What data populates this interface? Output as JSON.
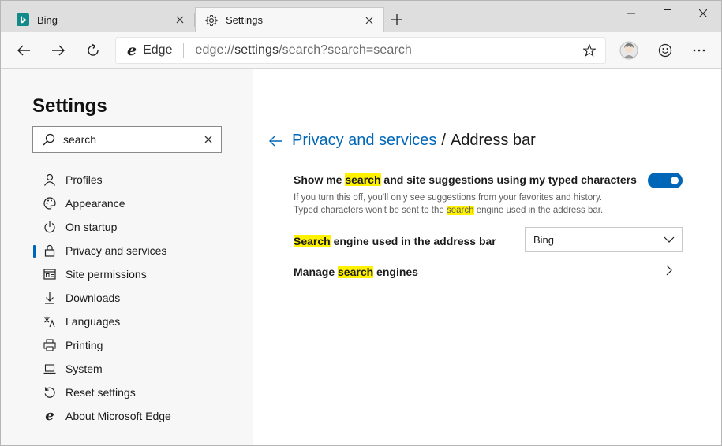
{
  "tabs": [
    {
      "title": "Bing",
      "icon": "bing-icon"
    },
    {
      "title": "Settings",
      "icon": "gear-icon"
    }
  ],
  "address": {
    "brand": "Edge",
    "url_scheme": "edge://",
    "url_host": "settings",
    "url_path": "/search?search=search"
  },
  "sidebar": {
    "title": "Settings",
    "search_value": "search",
    "items": [
      {
        "label": "Profiles",
        "icon": "person-icon"
      },
      {
        "label": "Appearance",
        "icon": "palette-icon"
      },
      {
        "label": "On startup",
        "icon": "power-icon"
      },
      {
        "label": "Privacy and services",
        "icon": "lock-icon",
        "selected": true
      },
      {
        "label": "Site permissions",
        "icon": "site-permissions-icon"
      },
      {
        "label": "Downloads",
        "icon": "download-icon"
      },
      {
        "label": "Languages",
        "icon": "languages-icon"
      },
      {
        "label": "Printing",
        "icon": "printer-icon"
      },
      {
        "label": "System",
        "icon": "laptop-icon"
      },
      {
        "label": "Reset settings",
        "icon": "reset-icon"
      },
      {
        "label": "About Microsoft Edge",
        "icon": "edge-logo-icon"
      }
    ]
  },
  "main": {
    "breadcrumb_parent": "Privacy and services",
    "breadcrumb_separator": "/",
    "breadcrumb_current": "Address bar",
    "suggestions": {
      "title_before": "Show me ",
      "title_highlight": "search",
      "title_after": " and site suggestions using my typed characters",
      "desc_line1": "If you turn this off, you'll only see suggestions from your favorites and history.",
      "desc_line2_before": "Typed characters won't be sent to the ",
      "desc_line2_highlight": "search",
      "desc_line2_after": " engine used in the address bar.",
      "toggle_on": true
    },
    "engine": {
      "label_highlight": "Search",
      "label_after": " engine used in the address bar",
      "selected": "Bing"
    },
    "manage": {
      "label_before": "Manage ",
      "label_highlight": "search",
      "label_after": " engines"
    }
  },
  "colors": {
    "accent": "#0067b8",
    "highlight": "#fff200"
  }
}
